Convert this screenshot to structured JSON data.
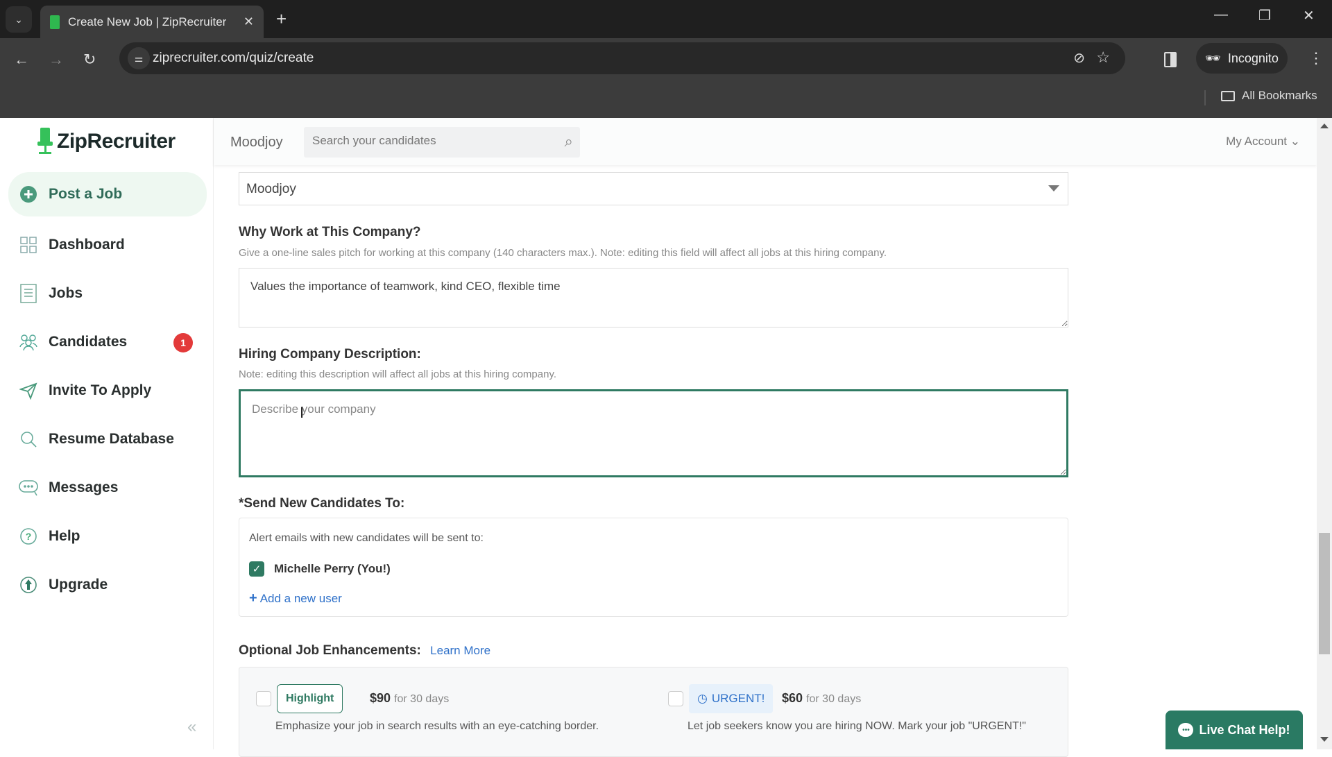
{
  "browser": {
    "tab_title": "Create New Job | ZipRecruiter",
    "url": "ziprecruiter.com/quiz/create",
    "incognito_label": "Incognito",
    "bookmarks_label": "All Bookmarks"
  },
  "sidebar": {
    "logo_text": "ZipRecruiter",
    "items": [
      {
        "label": "Post a Job",
        "icon": "plus-circle-icon",
        "active": true
      },
      {
        "label": "Dashboard",
        "icon": "grid-icon"
      },
      {
        "label": "Jobs",
        "icon": "document-icon"
      },
      {
        "label": "Candidates",
        "icon": "people-icon",
        "badge": "1"
      },
      {
        "label": "Invite To Apply",
        "icon": "send-icon"
      },
      {
        "label": "Resume Database",
        "icon": "search-icon"
      },
      {
        "label": "Messages",
        "icon": "chat-icon"
      },
      {
        "label": "Help",
        "icon": "help-icon"
      },
      {
        "label": "Upgrade",
        "icon": "upgrade-icon"
      }
    ],
    "collapse_icon": "«"
  },
  "header": {
    "company": "Moodjoy",
    "search_placeholder": "Search your candidates",
    "account_label": "My Account ⌄"
  },
  "form": {
    "company_select_value": "Moodjoy",
    "why_work": {
      "label": "Why Work at This Company?",
      "hint": "Give a one-line sales pitch for working at this company (140 characters max.). Note: editing this field will affect all jobs at this hiring company.",
      "value": "Values the importance of teamwork, kind CEO, flexible time"
    },
    "description": {
      "label": "Hiring Company Description:",
      "hint": "Note: editing this description will affect all jobs at this hiring company.",
      "placeholder": "Describe your company",
      "value": ""
    },
    "send_to": {
      "label": "*Send New Candidates To:",
      "alert_text": "Alert emails with new candidates will be sent to:",
      "recipient": "Michelle Perry (You!)",
      "recipient_checked": true,
      "add_user": "Add a new user"
    },
    "enhancements": {
      "label": "Optional Job Enhancements:",
      "learn_more": "Learn More",
      "items": [
        {
          "badge": "Highlight",
          "price": "$90",
          "period": "for 30 days",
          "description": "Emphasize your job in search results with an eye-catching border.",
          "checked": false
        },
        {
          "badge": "URGENT!",
          "price": "$60",
          "period": "for 30 days",
          "description": "Let job seekers know you are hiring NOW. Mark your job \"URGENT!\"",
          "checked": false
        }
      ]
    }
  },
  "live_chat": {
    "label": "Live Chat Help!"
  },
  "colors": {
    "brand_green": "#2f7a62",
    "logo_green": "#35c15a",
    "link_blue": "#2f71c9",
    "badge_red": "#e33a3a"
  }
}
